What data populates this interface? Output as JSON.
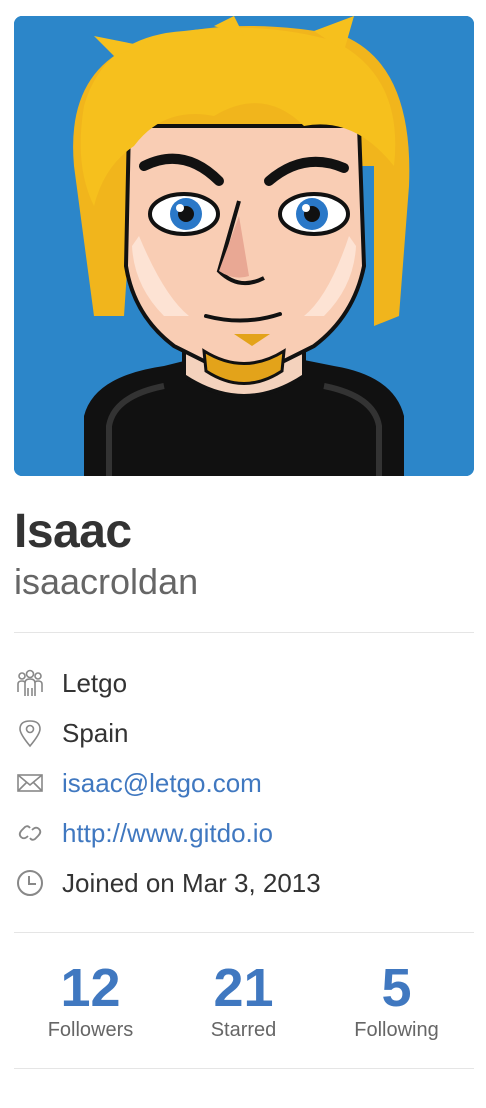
{
  "profile": {
    "full_name": "Isaac",
    "username": "isaacroldan"
  },
  "details": {
    "organization": {
      "icon": "organization-icon",
      "text": "Letgo"
    },
    "location": {
      "icon": "location-pin-icon",
      "text": "Spain"
    },
    "email": {
      "icon": "mail-icon",
      "text": "isaac@letgo.com"
    },
    "website": {
      "icon": "link-icon",
      "text": "http://www.gitdo.io"
    },
    "joined": {
      "icon": "clock-icon",
      "text": "Joined on Mar 3, 2013"
    }
  },
  "stats": {
    "followers": {
      "count": "12",
      "label": "Followers"
    },
    "starred": {
      "count": "21",
      "label": "Starred"
    },
    "following": {
      "count": "5",
      "label": "Following"
    }
  },
  "colors": {
    "link": "#4078c0",
    "avatar_background": "#2c86c9",
    "hair": "#f1b51c"
  }
}
